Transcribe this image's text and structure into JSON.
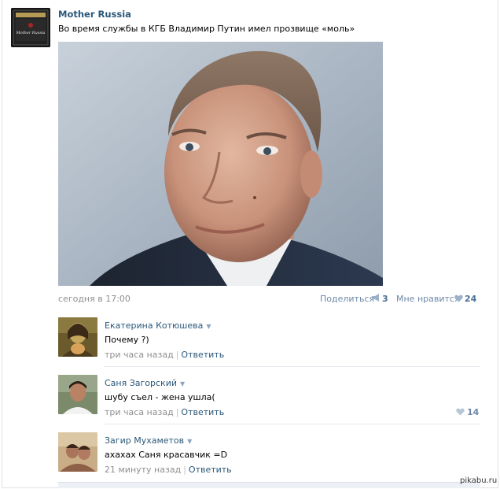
{
  "post": {
    "author": "Mother Russia",
    "avatar_caption": "Mother Russia",
    "text": "Во время службы в КГБ Владимир Путин имел прозвище «моль»",
    "photo": "portrait-photo",
    "date": "сегодня в 17:00",
    "share_label": "Поделиться",
    "share_count": "3",
    "like_label": "Мне нравится",
    "like_count": "24"
  },
  "comments": [
    {
      "name": "Екатерина Котюшева",
      "text": "Почему ?)",
      "time": "три часа назад",
      "reply": "Ответить",
      "likes": ""
    },
    {
      "name": "Саня Загорский",
      "text": "шубу съел - жена ушла(",
      "time": "три часа назад",
      "reply": "Ответить",
      "likes": "14"
    },
    {
      "name": "Загир Мухаметов",
      "text": "ахахах Саня красавчик =D",
      "time": "21 минуту назад",
      "reply": "Ответить",
      "likes": ""
    }
  ],
  "watermark": "pikabu.ru",
  "colors": {
    "link": "#2b587a",
    "muted": "#8f8f8f",
    "action": "#6e89a8"
  }
}
